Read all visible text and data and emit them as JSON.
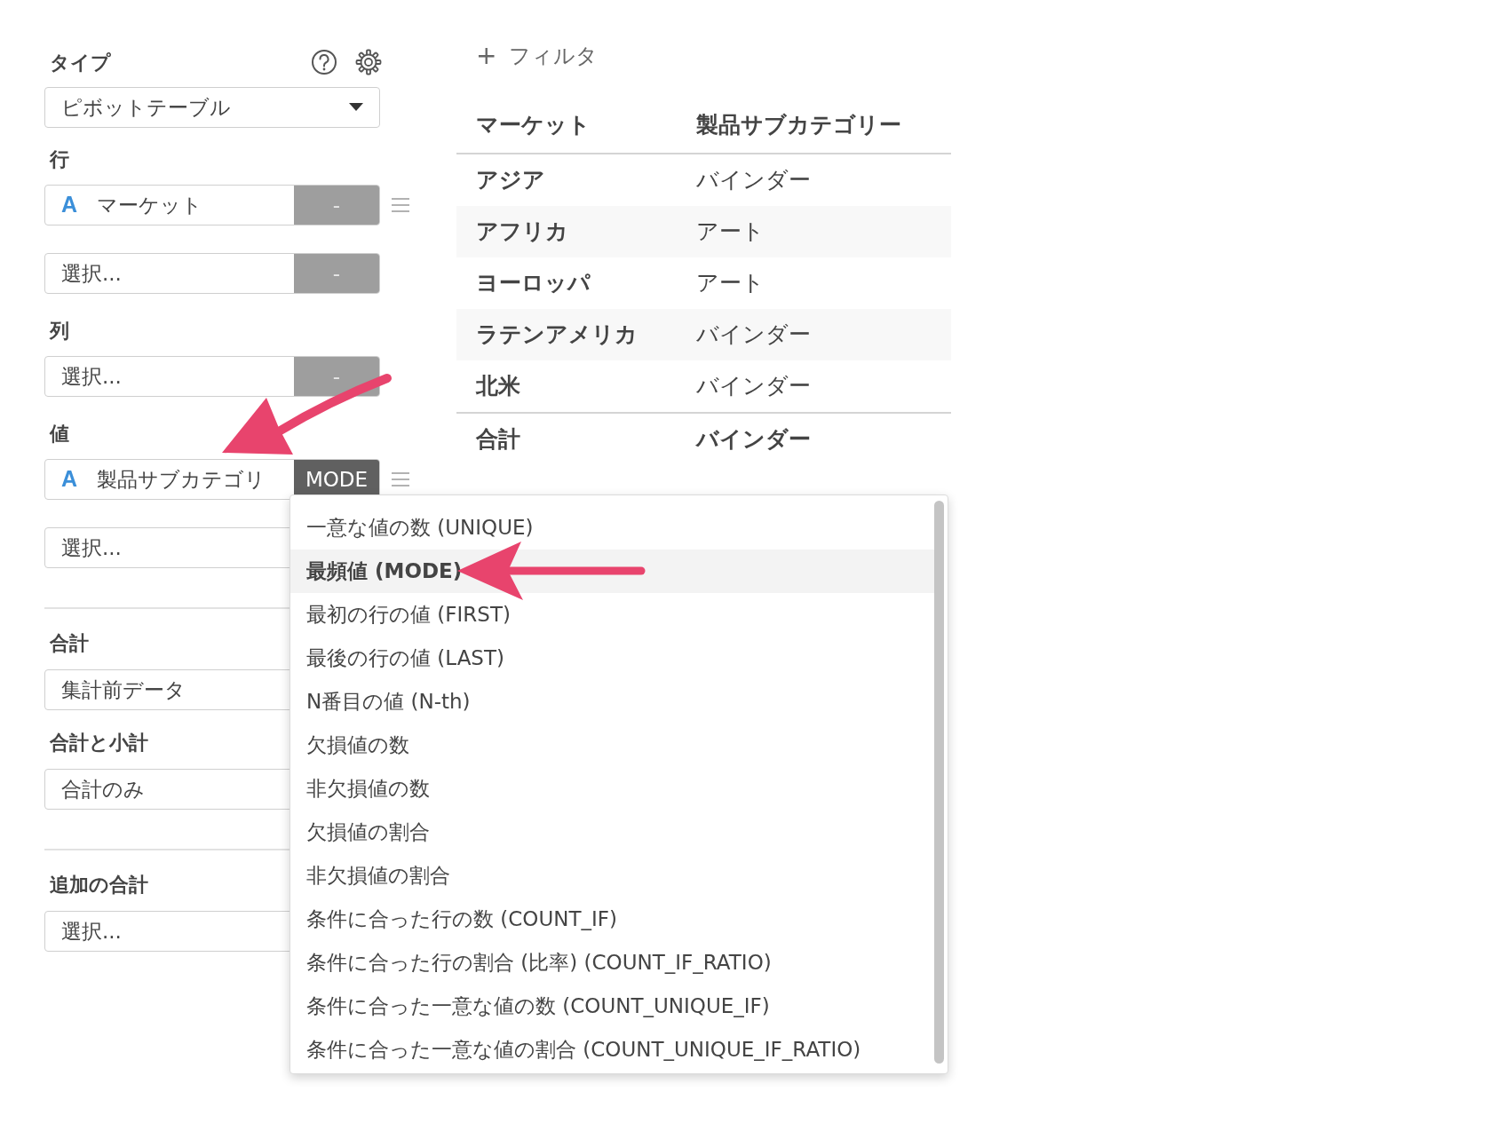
{
  "type_section": {
    "label": "タイプ",
    "value": "ピボットテーブル"
  },
  "sections": [
    {
      "label": "行",
      "fields": [
        {
          "type_icon": "A",
          "text": "マーケット",
          "button": {
            "label": "-",
            "open": false
          },
          "handle": true
        },
        {
          "text": "選択...",
          "button": {
            "label": "-",
            "open": false
          },
          "handle": false
        }
      ]
    },
    {
      "label": "列",
      "fields": [
        {
          "text": "選択...",
          "button": {
            "label": "-",
            "open": false
          },
          "handle": false
        }
      ]
    },
    {
      "label": "値",
      "fields": [
        {
          "type_icon": "A",
          "text": "製品サブカテゴリ",
          "button": {
            "label": "MODE",
            "open": true
          },
          "handle": true
        },
        {
          "text": "選択...",
          "handle": false
        }
      ]
    }
  ],
  "options": [
    {
      "label": "合計",
      "value": "集計前データ",
      "divider_before": true
    },
    {
      "label": "合計と小計",
      "value": "合計のみ",
      "divider_before": false
    },
    {
      "label": "追加の合計",
      "value": "選択...",
      "divider_before": true
    }
  ],
  "filter_button": {
    "icon": "+",
    "label": "フィルタ"
  },
  "table": {
    "columns": [
      "マーケット",
      "製品サブカテゴリー"
    ],
    "rows": [
      [
        "アジア",
        "バインダー"
      ],
      [
        "アフリカ",
        "アート"
      ],
      [
        "ヨーロッパ",
        "アート"
      ],
      [
        "ラテンアメリカ",
        "バインダー"
      ],
      [
        "北米",
        "バインダー"
      ]
    ],
    "total": [
      "合計",
      "バインダー"
    ]
  },
  "dropdown": {
    "items": [
      {
        "label": "一意な値の数 (UNIQUE)",
        "selected": false
      },
      {
        "label": "最頻値 (MODE)",
        "selected": true
      },
      {
        "label": "最初の行の値 (FIRST)",
        "selected": false
      },
      {
        "label": "最後の行の値 (LAST)",
        "selected": false
      },
      {
        "label": "N番目の値 (N-th)",
        "selected": false
      },
      {
        "label": "欠損値の数",
        "selected": false
      },
      {
        "label": "非欠損値の数",
        "selected": false
      },
      {
        "label": "欠損値の割合",
        "selected": false
      },
      {
        "label": "非欠損値の割合",
        "selected": false
      },
      {
        "label": "条件に合った行の数 (COUNT_IF)",
        "selected": false
      },
      {
        "label": "条件に合った行の割合 (比率) (COUNT_IF_RATIO)",
        "selected": false
      },
      {
        "label": "条件に合った一意な値の数 (COUNT_UNIQUE_IF)",
        "selected": false
      },
      {
        "label": "条件に合った一意な値の割合 (COUNT_UNIQUE_IF_RATIO)",
        "selected": false
      }
    ]
  }
}
